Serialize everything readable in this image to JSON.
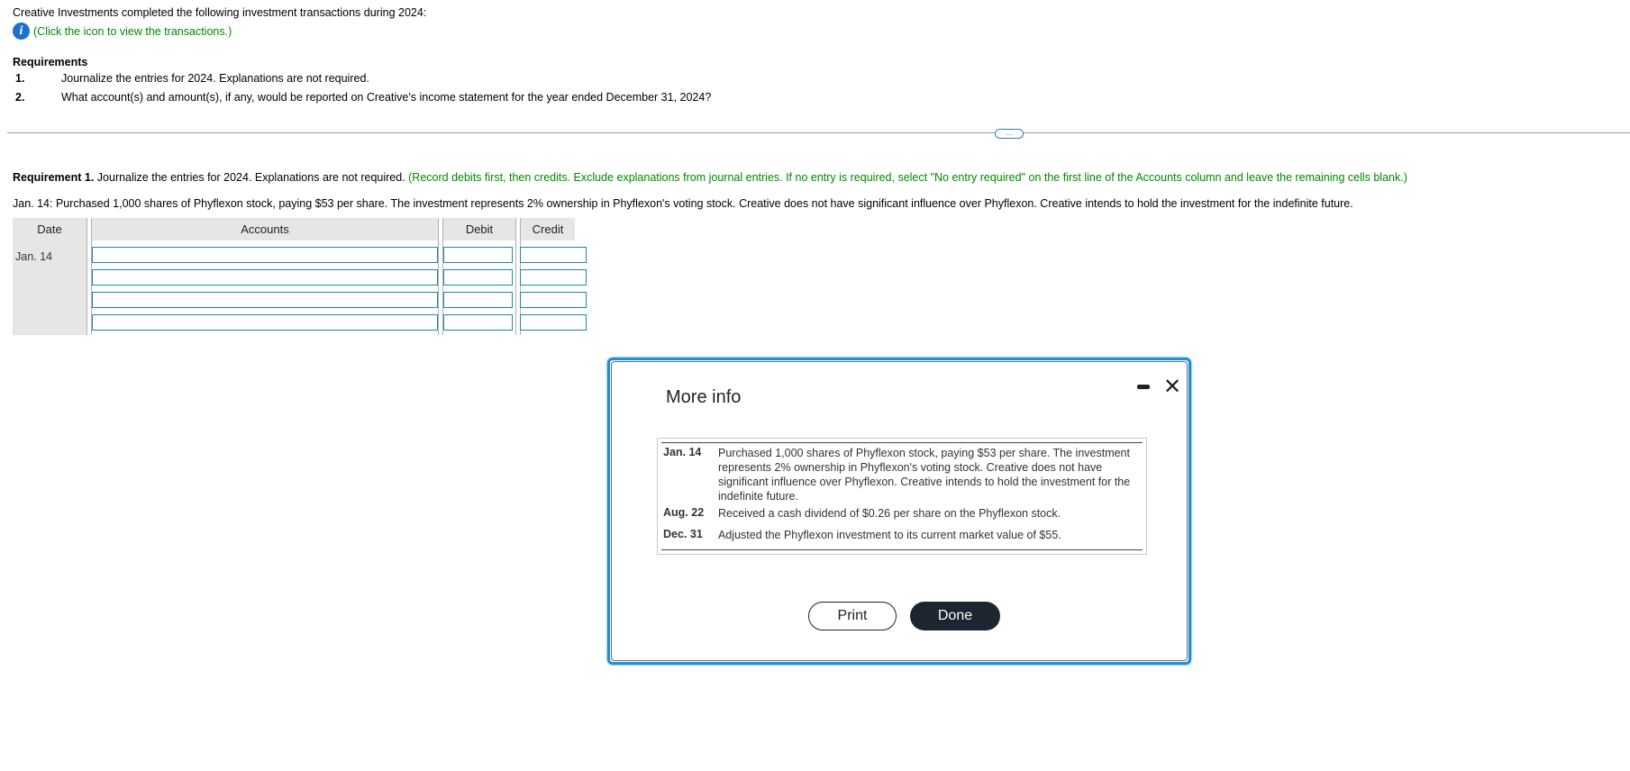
{
  "intro": "Creative Investments completed the following investment transactions during 2024:",
  "info_link": "(Click the icon to view the transactions.)",
  "requirements": {
    "heading": "Requirements",
    "items": [
      {
        "num": "1.",
        "text": "Journalize the entries for 2024. Explanations are not required."
      },
      {
        "num": "2.",
        "text": "What account(s) and amount(s), if any, would be reported on Creative's income statement for the year ended December 31, 2024?"
      }
    ]
  },
  "toggle_label": "…",
  "req1": {
    "bold": "Requirement 1.",
    "text": " Journalize the entries for 2024. Explanations are not required. ",
    "instructions": "(Record debits first, then credits. Exclude explanations from journal entries. If no entry is required, select \"No entry required\" on the first line of the Accounts column and leave the remaining cells blank.)"
  },
  "transaction_line": "Jan. 14: Purchased 1,000 shares of Phyflexon stock, paying $53 per share. The investment represents 2% ownership in Phyflexon's voting stock. Creative does not have significant influence over Phyflexon. Creative intends to hold the investment for the indefinite future.",
  "journal": {
    "headers": {
      "date": "Date",
      "accounts": "Accounts",
      "debit": "Debit",
      "credit": "Credit"
    },
    "date_value": "Jan. 14",
    "rows": 4
  },
  "modal": {
    "title": "More info",
    "transactions": [
      {
        "date": "Jan. 14",
        "text": "Purchased 1,000 shares of Phyflexon stock, paying $53 per share. The investment represents 2% ownership in Phyflexon's voting stock. Creative does not have significant influence over Phyflexon. Creative intends to hold the investment for the indefinite future."
      },
      {
        "date": "Aug. 22",
        "text": "Received a cash dividend of $0.26 per share on the Phyflexon stock."
      },
      {
        "date": "Dec. 31",
        "text": "Adjusted the Phyflexon investment to its current market value of $55."
      }
    ],
    "print_label": "Print",
    "done_label": "Done",
    "close_label": "✕"
  },
  "colors": {
    "green_text": "#008800",
    "accent_blue": "#1f8fd6",
    "field_border": "#1e88a8",
    "done_bg": "#1c2530"
  }
}
